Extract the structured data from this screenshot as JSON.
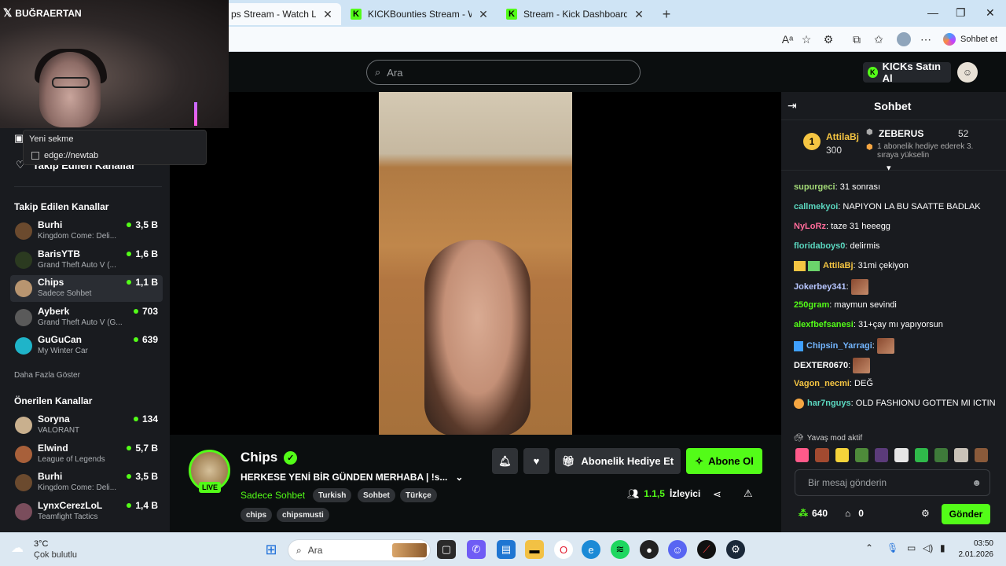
{
  "browser": {
    "tabs": [
      {
        "title": "ps Stream - Watch Live on",
        "active": true
      },
      {
        "title": "KICKBounties Stream - Watch Live",
        "active": false
      },
      {
        "title": "Stream - Kick Dashboard",
        "active": false
      }
    ],
    "copilot_label": "Sohbet et"
  },
  "overlay": {
    "streamer_name": "BUĞRAERTAN",
    "popup_title": "Yeni sekme",
    "popup_url": "edge://newtab"
  },
  "nav": {
    "search_placeholder": "Ara",
    "kicks_button": "KICKs Satın Al"
  },
  "sidebar": {
    "following_link": "Takip Edilen Kanallar",
    "followed_heading": "Takip Edilen Kanallar",
    "followed": [
      {
        "name": "Burhi",
        "sub": "Kingdom Come: Deli...",
        "viewers": "3,5 B",
        "color": "#6b4a2e"
      },
      {
        "name": "BarisYTB",
        "sub": "Grand Theft Auto V (...",
        "viewers": "1,6 B",
        "color": "#2b3a20"
      },
      {
        "name": "Chips",
        "sub": "Sadece Sohbet",
        "viewers": "1,1 B",
        "color": "#b89570"
      },
      {
        "name": "Ayberk",
        "sub": "Grand Theft Auto V (G...",
        "viewers": "703",
        "color": "#5a5a5a"
      },
      {
        "name": "GuGuCan",
        "sub": "My Winter Car",
        "viewers": "639",
        "color": "#1fb4c9"
      }
    ],
    "show_more": "Daha Fazla Göster",
    "recommended_heading": "Önerilen Kanallar",
    "recommended": [
      {
        "name": "Soryna",
        "sub": "VALORANT",
        "viewers": "134",
        "color": "#c9b08e"
      },
      {
        "name": "Elwind",
        "sub": "League of Legends",
        "viewers": "5,7 B",
        "color": "#a8603a"
      },
      {
        "name": "Burhi",
        "sub": "Kingdom Come: Deli...",
        "viewers": "3,5 B",
        "color": "#6b4a2e"
      },
      {
        "name": "LynxCerezLoL",
        "sub": "Teamfight Tactics",
        "viewers": "1,4 B",
        "color": "#7a4d5c"
      }
    ]
  },
  "stream": {
    "channel": "Chips",
    "live_label": "LIVE",
    "title": "HERKESE YENİ BİR GÜNDEN MERHABA | !s...",
    "category": "Sadece Sohbet",
    "tags_row1": [
      "Turkish",
      "Sohbet",
      "Türkçe"
    ],
    "tags_row2": [
      "chips",
      "chipsmusti"
    ],
    "gift_button": "Abonelik Hediye Et",
    "subscribe_button": "Abone Ol",
    "viewers": "1.1,5",
    "viewers_label": "İzleyici"
  },
  "chat": {
    "title": "Sohbet",
    "leaderboard": {
      "first_name": "AttilaBj",
      "first_value": "300",
      "second_name": "ZEBERUS",
      "second_value": "52",
      "note": "1 abonelik hediye ederek 3. sıraya yükselin"
    },
    "messages": [
      {
        "user": "supurgeci",
        "color": "#a3d977",
        "text": "31 sonrası"
      },
      {
        "user": "callmekyoi",
        "color": "#5bd8c0",
        "text": "NAPIYON LA BU SAATTE BADLAK"
      },
      {
        "user": "NyLoRz",
        "color": "#ff6b9a",
        "text": "taze 31 heeegg"
      },
      {
        "user": "floridaboys0",
        "color": "#5bd8c0",
        "text": "delirmis"
      },
      {
        "user": "AttilaBj",
        "color": "#f5c542",
        "text": "31mi çekiyon"
      },
      {
        "user": "Jokerbey341",
        "color": "#b7c6ff",
        "text": ""
      },
      {
        "user": "250gram",
        "color": "#53fc18",
        "text": "maymun sevindi"
      },
      {
        "user": "alexfbefsanesi",
        "color": "#53fc18",
        "text": "31+çay mı yapıyorsun"
      },
      {
        "user": "Chipsin_Yarragi",
        "color": "#73b6ff",
        "text": ""
      },
      {
        "user": "DEXTER0670",
        "color": "#ffffff",
        "text": ""
      },
      {
        "user": "Vagon_necmi",
        "color": "#f5c542",
        "text": "DEĞ"
      },
      {
        "user": "har7nguys",
        "color": "#5bd8c0",
        "text": "OLD FASHIONU GOTTEN MI ICTIN"
      }
    ],
    "slow_mode": "Yavaş mod aktif",
    "input_placeholder": "Bir mesaj gönderin",
    "points": "640",
    "kicks": "0",
    "send_button": "Gönder"
  },
  "taskbar": {
    "weather_temp": "3°C",
    "weather_text": "Çok bulutlu",
    "search_placeholder": "Ara",
    "time": "03:50",
    "date": "2.01.2026"
  }
}
